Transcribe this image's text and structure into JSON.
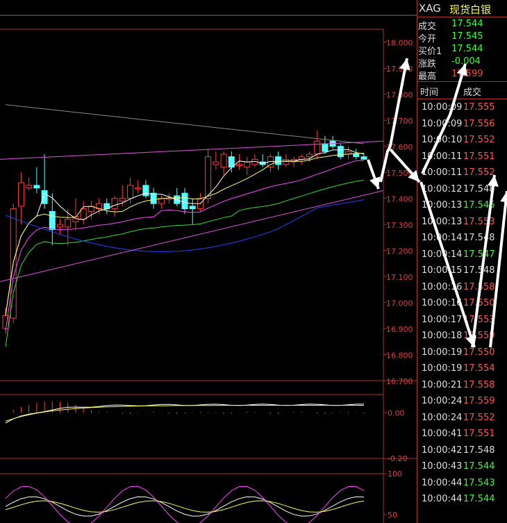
{
  "chart_data": [
    {
      "type": "candlestick",
      "ylim": [
        16.7,
        18.05
      ],
      "y_ticks": [
        "18.000",
        "17.900",
        "17.800",
        "17.700",
        "17.600",
        "17.500",
        "17.400",
        "17.300",
        "17.200",
        "17.100",
        "17.000",
        "16.900",
        "16.800",
        "16.700"
      ],
      "candles": [
        {
          "o": 16.9,
          "h": 16.98,
          "l": 16.88,
          "c": 16.95
        },
        {
          "o": 16.94,
          "h": 17.38,
          "l": 16.92,
          "c": 17.36
        },
        {
          "o": 17.37,
          "h": 17.5,
          "l": 17.3,
          "c": 17.46
        },
        {
          "o": 17.44,
          "h": 17.48,
          "l": 17.43,
          "c": 17.45
        },
        {
          "o": 17.45,
          "h": 17.52,
          "l": 17.42,
          "c": 17.44
        },
        {
          "o": 17.43,
          "h": 17.57,
          "l": 17.36,
          "c": 17.38
        },
        {
          "o": 17.35,
          "h": 17.42,
          "l": 17.22,
          "c": 17.28
        },
        {
          "o": 17.29,
          "h": 17.32,
          "l": 17.26,
          "c": 17.3
        },
        {
          "o": 17.29,
          "h": 17.36,
          "l": 17.22,
          "c": 17.32
        },
        {
          "o": 17.31,
          "h": 17.4,
          "l": 17.28,
          "c": 17.33
        },
        {
          "o": 17.32,
          "h": 17.39,
          "l": 17.3,
          "c": 17.36
        },
        {
          "o": 17.35,
          "h": 17.39,
          "l": 17.32,
          "c": 17.37
        },
        {
          "o": 17.36,
          "h": 17.4,
          "l": 17.34,
          "c": 17.38
        },
        {
          "o": 17.38,
          "h": 17.4,
          "l": 17.34,
          "c": 17.36
        },
        {
          "o": 17.36,
          "h": 17.41,
          "l": 17.33,
          "c": 17.4
        },
        {
          "o": 17.39,
          "h": 17.45,
          "l": 17.37,
          "c": 17.4
        },
        {
          "o": 17.4,
          "h": 17.48,
          "l": 17.38,
          "c": 17.45
        },
        {
          "o": 17.44,
          "h": 17.47,
          "l": 17.42,
          "c": 17.44
        },
        {
          "o": 17.45,
          "h": 17.47,
          "l": 17.4,
          "c": 17.41
        },
        {
          "o": 17.42,
          "h": 17.44,
          "l": 17.36,
          "c": 17.38
        },
        {
          "o": 17.38,
          "h": 17.41,
          "l": 17.36,
          "c": 17.4
        },
        {
          "o": 17.4,
          "h": 17.42,
          "l": 17.38,
          "c": 17.4
        },
        {
          "o": 17.41,
          "h": 17.44,
          "l": 17.37,
          "c": 17.38
        },
        {
          "o": 17.42,
          "h": 17.44,
          "l": 17.34,
          "c": 17.36
        },
        {
          "o": 17.37,
          "h": 17.4,
          "l": 17.3,
          "c": 17.36
        },
        {
          "o": 17.36,
          "h": 17.42,
          "l": 17.35,
          "c": 17.4
        },
        {
          "o": 17.4,
          "h": 17.59,
          "l": 17.38,
          "c": 17.56
        },
        {
          "o": 17.53,
          "h": 17.58,
          "l": 17.51,
          "c": 17.54
        },
        {
          "o": 17.52,
          "h": 17.58,
          "l": 17.49,
          "c": 17.57
        },
        {
          "o": 17.56,
          "h": 17.58,
          "l": 17.5,
          "c": 17.52
        },
        {
          "o": 17.53,
          "h": 17.57,
          "l": 17.51,
          "c": 17.53
        },
        {
          "o": 17.52,
          "h": 17.56,
          "l": 17.49,
          "c": 17.54
        },
        {
          "o": 17.53,
          "h": 17.57,
          "l": 17.52,
          "c": 17.55
        },
        {
          "o": 17.54,
          "h": 17.57,
          "l": 17.52,
          "c": 17.53
        },
        {
          "o": 17.52,
          "h": 17.57,
          "l": 17.5,
          "c": 17.56
        },
        {
          "o": 17.56,
          "h": 17.58,
          "l": 17.51,
          "c": 17.53
        },
        {
          "o": 17.53,
          "h": 17.57,
          "l": 17.52,
          "c": 17.55
        },
        {
          "o": 17.54,
          "h": 17.56,
          "l": 17.52,
          "c": 17.55
        },
        {
          "o": 17.55,
          "h": 17.57,
          "l": 17.53,
          "c": 17.56
        },
        {
          "o": 17.56,
          "h": 17.58,
          "l": 17.54,
          "c": 17.57
        },
        {
          "o": 17.57,
          "h": 17.66,
          "l": 17.55,
          "c": 17.62
        },
        {
          "o": 17.61,
          "h": 17.64,
          "l": 17.57,
          "c": 17.58
        },
        {
          "o": 17.62,
          "h": 17.64,
          "l": 17.59,
          "c": 17.6
        },
        {
          "o": 17.6,
          "h": 17.61,
          "l": 17.55,
          "c": 17.56
        },
        {
          "o": 17.57,
          "h": 17.6,
          "l": 17.55,
          "c": 17.58
        },
        {
          "o": 17.57,
          "h": 17.59,
          "l": 17.55,
          "c": 17.56
        },
        {
          "o": 17.56,
          "h": 17.57,
          "l": 17.55,
          "c": 17.55
        }
      ],
      "colors": {
        "up": "#ff3c3c",
        "down": "#54ffff",
        "grid": "#b03030",
        "axis_text": "#e04040"
      }
    },
    {
      "type": "line",
      "ylim": [
        -0.2,
        0.08
      ],
      "y_ticks": [
        "0.00",
        "-0.20"
      ]
    },
    {
      "type": "line",
      "ylim": [
        0,
        100
      ],
      "y_ticks": [
        "100",
        "50"
      ]
    }
  ],
  "panel": {
    "code": "XAG",
    "name": "现货白银",
    "quote": [
      {
        "label": "成交",
        "value": "17.544",
        "color": "#33ff33"
      },
      {
        "label": "今开",
        "value": "17.545",
        "color": "#33ff33"
      },
      {
        "label": "买价1",
        "value": "17.544",
        "color": "#33ff33"
      },
      {
        "label": "涨跌",
        "value": "-0.004",
        "color": "#33ff33"
      },
      {
        "label": "最高",
        "value": "17.599",
        "color": "#ff4444"
      }
    ],
    "col_time": "时间",
    "col_price": "成交",
    "ticks": [
      {
        "time": "10:00:09",
        "price": "17.555",
        "color": "#ff5555"
      },
      {
        "time": "10:00:09",
        "price": "17.556",
        "color": "#ff5555"
      },
      {
        "time": "10:00:10",
        "price": "17.552",
        "color": "#ff5555"
      },
      {
        "time": "10:00:11",
        "price": "17.551",
        "color": "#ff5555"
      },
      {
        "time": "10:00:11",
        "price": "17.552",
        "color": "#ff5555"
      },
      {
        "time": "10:00:12",
        "price": "17.548",
        "color": "#dddddd"
      },
      {
        "time": "10:00:13",
        "price": "17.546",
        "color": "#33ff33"
      },
      {
        "time": "10:00:13",
        "price": "17.553",
        "color": "#ff5555"
      },
      {
        "time": "10:00:14",
        "price": "17.548",
        "color": "#dddddd"
      },
      {
        "time": "10:00:14",
        "price": "17.547",
        "color": "#33ff33"
      },
      {
        "time": "10:00:15",
        "price": "17.548",
        "color": "#dddddd"
      },
      {
        "time": "10:00:16",
        "price": "17.558",
        "color": "#ff5555"
      },
      {
        "time": "10:00:16",
        "price": "17.550",
        "color": "#ff5555"
      },
      {
        "time": "10:00:17",
        "price": "17.553",
        "color": "#ff5555"
      },
      {
        "time": "10:00:18",
        "price": "17.559",
        "color": "#ff5555"
      },
      {
        "time": "10:00:19",
        "price": "17.550",
        "color": "#ff5555"
      },
      {
        "time": "10:00:19",
        "price": "17.554",
        "color": "#ff5555"
      },
      {
        "time": "10:00:21",
        "price": "17.558",
        "color": "#ff5555"
      },
      {
        "time": "10:00:24",
        "price": "17.559",
        "color": "#ff5555"
      },
      {
        "time": "10:00:24",
        "price": "17.552",
        "color": "#ff5555"
      },
      {
        "time": "10:00:41",
        "price": "17.551",
        "color": "#ff5555"
      },
      {
        "time": "10:00:42",
        "price": "17.548",
        "color": "#dddddd"
      },
      {
        "time": "10:00:43",
        "price": "17.544",
        "color": "#33ff33"
      },
      {
        "time": "10:00:44",
        "price": "17.543",
        "color": "#33ff33"
      },
      {
        "time": "10:00:44",
        "price": "17.544",
        "color": "#33ff33"
      }
    ]
  }
}
